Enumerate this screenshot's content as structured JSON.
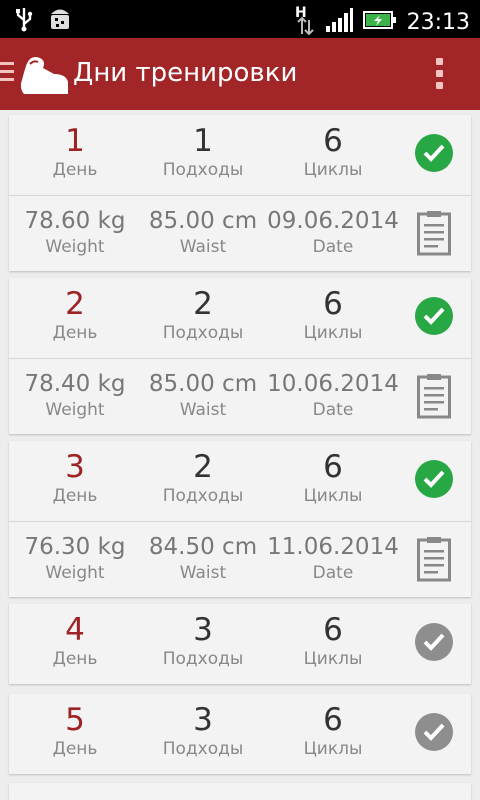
{
  "status_bar": {
    "time": "23:13",
    "network_label": "H",
    "icons": [
      "usb-icon",
      "android-debug-icon",
      "data-arrows-icon",
      "signal-icon",
      "battery-charging-icon"
    ]
  },
  "app_bar": {
    "title": "Дни тренировки",
    "icons": [
      "drawer-icon",
      "app-logo-icon",
      "overflow-menu-icon"
    ]
  },
  "labels": {
    "day": "День",
    "sets": "Подходы",
    "cycles": "Циклы",
    "weight": "Weight",
    "waist": "Waist",
    "date": "Date"
  },
  "colors": {
    "app_bar": "#a22528",
    "day_number": "#9d2326",
    "done": "#28a745",
    "pending": "#8e8e8e"
  },
  "days": [
    {
      "day": "1",
      "sets": "1",
      "cycles": "6",
      "done": true,
      "weight": "78.60 kg",
      "waist": "85.00 cm",
      "date": "09.06.2014"
    },
    {
      "day": "2",
      "sets": "2",
      "cycles": "6",
      "done": true,
      "weight": "78.40 kg",
      "waist": "85.00 cm",
      "date": "10.06.2014"
    },
    {
      "day": "3",
      "sets": "2",
      "cycles": "6",
      "done": true,
      "weight": "76.30 kg",
      "waist": "84.50 cm",
      "date": "11.06.2014"
    },
    {
      "day": "4",
      "sets": "3",
      "cycles": "6",
      "done": false
    },
    {
      "day": "5",
      "sets": "3",
      "cycles": "6",
      "done": false
    }
  ]
}
